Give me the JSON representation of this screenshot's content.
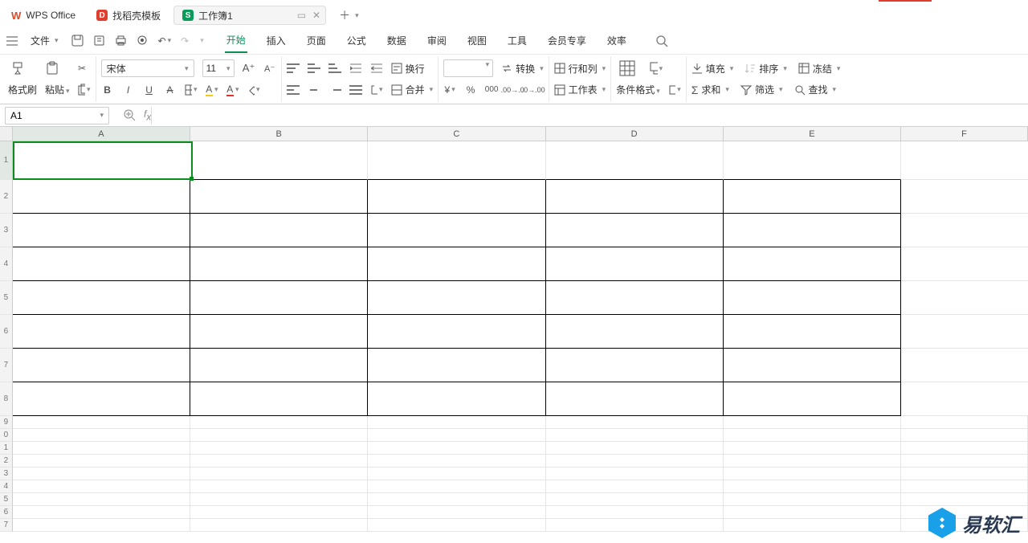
{
  "tabs": {
    "app_name": "WPS Office",
    "templates": "找稻壳模板",
    "file": "工作簿1"
  },
  "menu": {
    "file": "文件",
    "items": [
      "开始",
      "插入",
      "页面",
      "公式",
      "数据",
      "审阅",
      "视图",
      "工具",
      "会员专享",
      "效率"
    ],
    "active": 0
  },
  "ribbon": {
    "format_painter": "格式刷",
    "paste": "粘贴",
    "font_name": "宋体",
    "font_size": "11",
    "wrap": "换行",
    "merge": "合并",
    "convert": "转换",
    "row_col": "行和列",
    "worksheet": "工作表",
    "cond_fmt": "条件格式",
    "fill": "填充",
    "sort": "排序",
    "freeze": "冻结",
    "sum": "求和",
    "filter": "筛选",
    "find": "查找"
  },
  "namebox": "A1",
  "columns": [
    "A",
    "B",
    "C",
    "D",
    "E",
    "F"
  ],
  "rows_thick": [
    "1",
    "2",
    "3",
    "4",
    "5",
    "6",
    "7",
    "8"
  ],
  "rows_thin": [
    "9",
    "0",
    "1",
    "2",
    "3",
    "4",
    "5",
    "6",
    "7"
  ],
  "watermark": "易软汇"
}
